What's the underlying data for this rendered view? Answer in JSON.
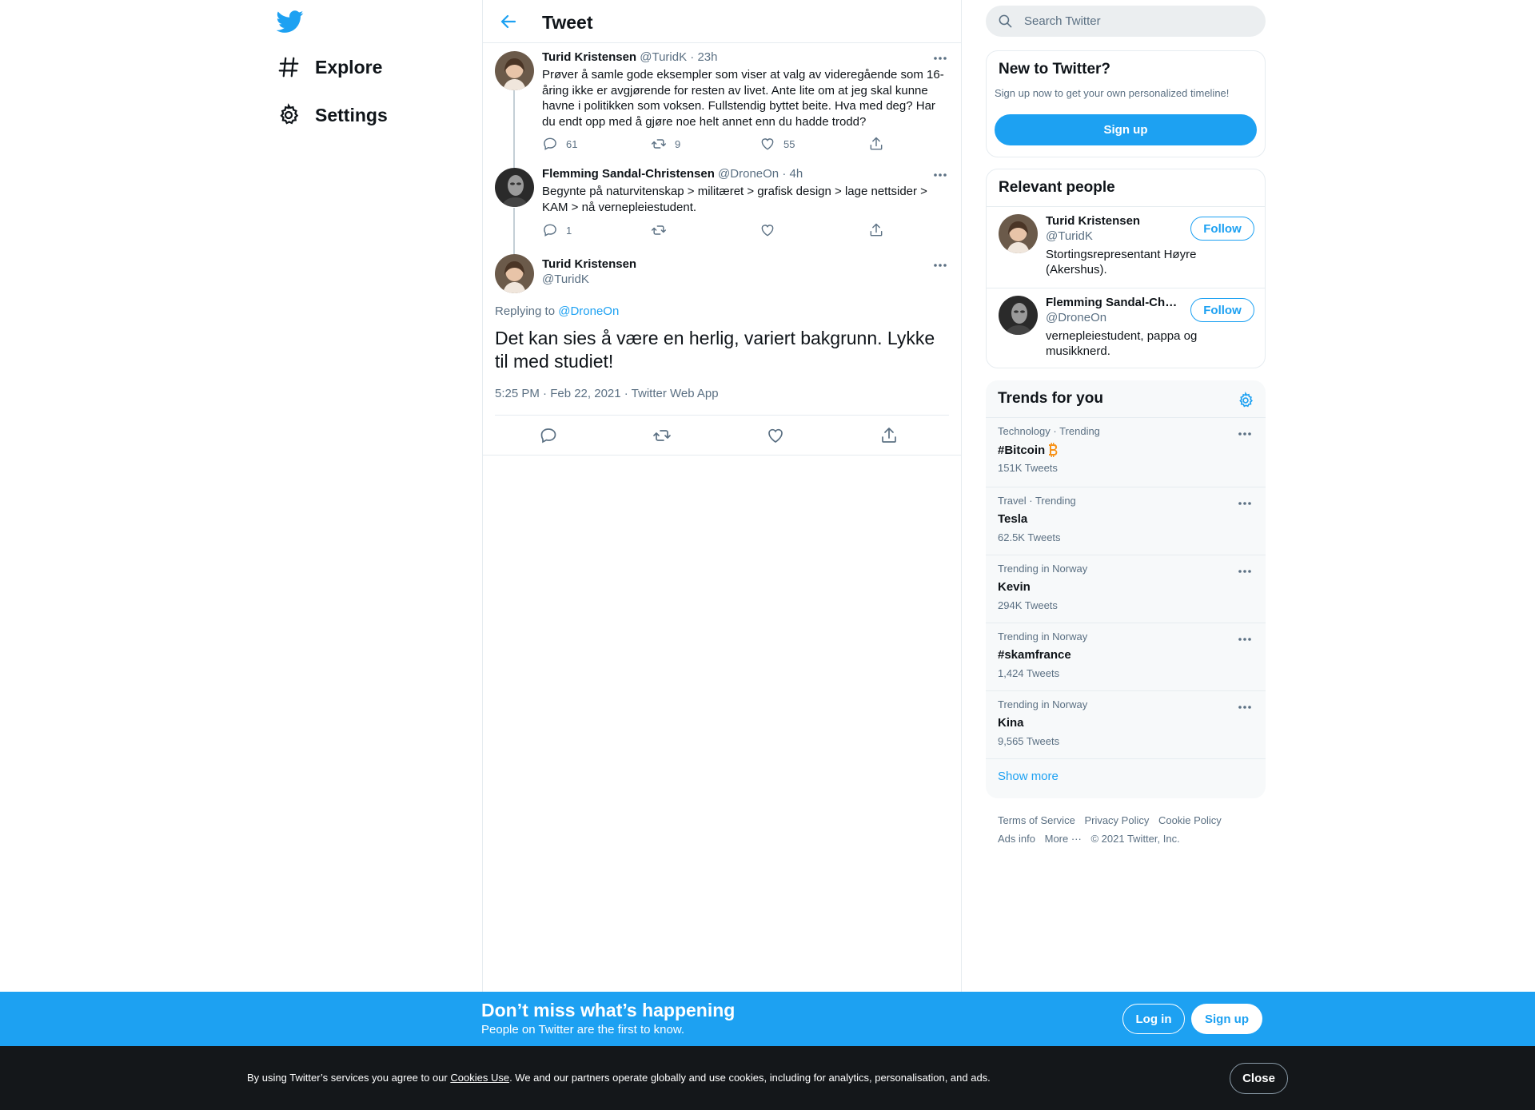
{
  "brand": {
    "accent": "#1da1f2",
    "text": "#0f1419",
    "muted": "#5b7083"
  },
  "nav": {
    "items": [
      {
        "label": "Explore",
        "icon": "hashtag-icon"
      },
      {
        "label": "Settings",
        "icon": "gear-icon"
      }
    ]
  },
  "header": {
    "title": "Tweet"
  },
  "thread": [
    {
      "name": "Turid Kristensen",
      "handle": "@TuridK",
      "time": "23h",
      "text": "Prøver å samle gode eksempler som viser at valg av videregående som 16-åring ikke er avgjørende for resten av livet. Ante lite om at jeg skal kunne havne i politikken som voksen. Fullstendig byttet beite. Hva med deg? Har du endt opp med å gjøre noe helt annet enn du hadde trodd?",
      "replies": "61",
      "retweets": "9",
      "likes": "55"
    },
    {
      "name": "Flemming Sandal-Christensen",
      "handle": "@DroneOn",
      "time": "4h",
      "text": "Begynte på naturvitenskap > militæret > grafisk design > lage nettsider > KAM > nå vernepleiestudent.",
      "replies": "1",
      "retweets": "",
      "likes": ""
    }
  ],
  "main_tweet": {
    "name": "Turid Kristensen",
    "handle": "@TuridK",
    "replying_prefix": "Replying to",
    "replying_to": "@DroneOn",
    "text": "Det kan sies å være en herlig, variert bakgrunn. Lykke til med studiet!",
    "meta": "5:25 PM · Feb 22, 2021 · Twitter Web App"
  },
  "search": {
    "placeholder": "Search Twitter"
  },
  "signup_card": {
    "title": "New to Twitter?",
    "subtitle": "Sign up now to get your own personalized timeline!",
    "button": "Sign up"
  },
  "relevant_people": {
    "title": "Relevant people",
    "people": [
      {
        "name": "Turid Kristensen",
        "handle": "@TuridK",
        "bio": "Stortingsrepresentant Høyre (Akershus).",
        "button": "Follow"
      },
      {
        "name": "Flemming Sandal-Christensen",
        "handle": "@DroneOn",
        "bio": "vernepleiestudent, pappa og musikknerd.",
        "button": "Follow"
      }
    ]
  },
  "trends": {
    "title": "Trends for you",
    "items": [
      {
        "context": "Technology · Trending",
        "name": "#Bitcoin",
        "count": "151K Tweets"
      },
      {
        "context": "Travel · Trending",
        "name": "Tesla",
        "count": "62.5K Tweets"
      },
      {
        "context": "Trending in Norway",
        "name": "Kevin",
        "count": "294K Tweets"
      },
      {
        "context": "Trending in Norway",
        "name": "#skamfrance",
        "count": "1,424 Tweets"
      },
      {
        "context": "Trending in Norway",
        "name": "Kina",
        "count": "9,565 Tweets"
      }
    ],
    "show_more": "Show more"
  },
  "footer": {
    "links": [
      "Terms of Service",
      "Privacy Policy",
      "Cookie Policy",
      "Ads info",
      "More ···"
    ],
    "copyright": "© 2021 Twitter, Inc."
  },
  "signup_bar": {
    "title": "Don’t miss what’s happening",
    "subtitle": "People on Twitter are the first to know.",
    "login": "Log in",
    "signup": "Sign up"
  },
  "cookie_bar": {
    "text_before": "By using Twitter’s services you agree to our ",
    "link": "Cookies Use",
    "text_after": ". We and our partners operate globally and use cookies, including for analytics, personalisation, and ads.",
    "close": "Close"
  }
}
